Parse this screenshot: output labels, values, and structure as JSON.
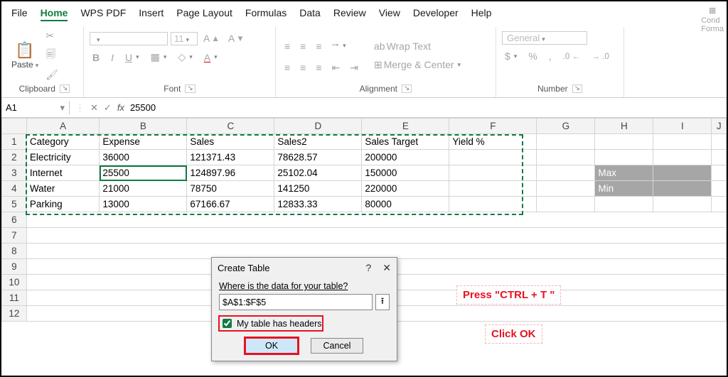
{
  "menu": {
    "file": "File",
    "home": "Home",
    "wps": "WPS PDF",
    "insert": "Insert",
    "page": "Page Layout",
    "formulas": "Formulas",
    "data": "Data",
    "review": "Review",
    "view": "View",
    "developer": "Developer",
    "help": "Help"
  },
  "ribbon": {
    "clipboard_label": "Clipboard",
    "paste": "Paste",
    "font_label": "Font",
    "font_size": "11",
    "alignment_label": "Alignment",
    "wrap_text": "Wrap Text",
    "merge_center": "Merge & Center",
    "number_label": "Number",
    "number_format": "General",
    "cond": "Cond\nForma"
  },
  "namebox": "A1",
  "formula": "25500",
  "cols": [
    "A",
    "B",
    "C",
    "D",
    "E",
    "F",
    "G",
    "H",
    "I",
    "J"
  ],
  "rows": [
    "1",
    "2",
    "3",
    "4",
    "5",
    "6",
    "7",
    "8",
    "9",
    "10",
    "11",
    "12"
  ],
  "headers": {
    "A": "Category",
    "B": "Expense",
    "C": "Sales",
    "D": "Sales2",
    "E": "Sales Target",
    "F": "Yield %"
  },
  "data": [
    {
      "A": "Electricity",
      "B": "36000",
      "C": "121371.43",
      "D": "78628.57",
      "E": "200000"
    },
    {
      "A": "Internet",
      "B": "25500",
      "C": "124897.96",
      "D": "25102.04",
      "E": "150000"
    },
    {
      "A": "Water",
      "B": "21000",
      "C": "78750",
      "D": "141250",
      "E": "220000"
    },
    {
      "A": "Parking",
      "B": "13000",
      "C": "67166.67",
      "D": "12833.33",
      "E": "80000"
    }
  ],
  "side": {
    "max": "Max",
    "min": "Min"
  },
  "dialog": {
    "title": "Create Table",
    "question": "Where is the data for your table?",
    "range": "$A$1:$F$5",
    "headers_ck": "My table has headers",
    "ok": "OK",
    "cancel": "Cancel"
  },
  "annot": {
    "hint1": "Press \"CTRL + T \"",
    "hint2": "Click OK"
  },
  "chart_data": {
    "type": "table",
    "title": "Expense / Sales data",
    "columns": [
      "Category",
      "Expense",
      "Sales",
      "Sales2",
      "Sales Target",
      "Yield %"
    ],
    "rows": [
      [
        "Electricity",
        36000,
        121371.43,
        78628.57,
        200000,
        null
      ],
      [
        "Internet",
        25500,
        124897.96,
        25102.04,
        150000,
        null
      ],
      [
        "Water",
        21000,
        78750,
        141250,
        220000,
        null
      ],
      [
        "Parking",
        13000,
        67166.67,
        12833.33,
        80000,
        null
      ]
    ]
  }
}
